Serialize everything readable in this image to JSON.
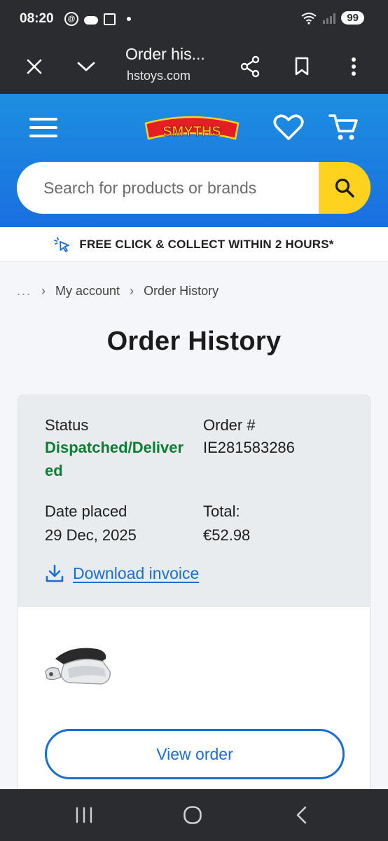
{
  "status_bar": {
    "time": "08:20",
    "battery": "99"
  },
  "browser": {
    "tab_title": "Order his...",
    "url": "hstoys.com"
  },
  "header": {
    "logo_text": "SMYTHS",
    "search_placeholder": "Search for products or brands"
  },
  "promo": {
    "text": "FREE CLICK & COLLECT WITHIN 2 HOURS*"
  },
  "breadcrumb": {
    "ellipsis": "...",
    "items": [
      "My account",
      "Order History"
    ]
  },
  "page": {
    "title": "Order History"
  },
  "order": {
    "status_label": "Status",
    "status_value": "Dispatched/Delivered",
    "order_no_label": "Order #",
    "order_no_value": "IE281583286",
    "date_label": "Date placed",
    "date_value": "29 Dec, 2025",
    "total_label": "Total:",
    "total_value": "€52.98",
    "download_label": "Download invoice",
    "view_button": "View order"
  },
  "colors": {
    "brand_blue": "#1a7fe0",
    "search_yellow": "#ffd21f",
    "status_green": "#0e7d33",
    "link_blue": "#1b6ed1"
  }
}
